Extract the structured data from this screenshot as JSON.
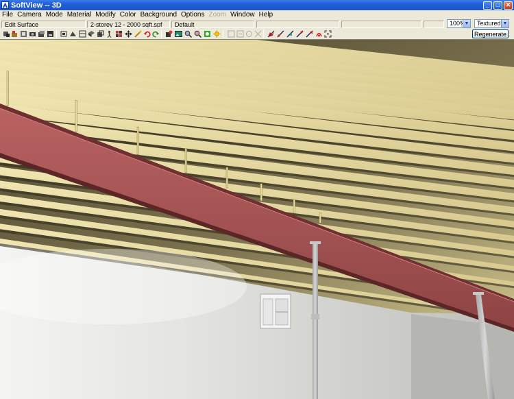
{
  "window": {
    "title": "SoftView -- 3D",
    "minimize": "_",
    "maximize": "□",
    "close": "✕"
  },
  "menu": [
    "File",
    "Camera",
    "Mode",
    "Material",
    "Modify",
    "Color",
    "Background",
    "Options",
    "Zoom",
    "Window",
    "Help"
  ],
  "menu_disabled": [
    "Zoom"
  ],
  "info": {
    "mode": "Edit Surface",
    "file": "2-storey 12 - 2000 sqft.spf",
    "layer": "Default",
    "zoom": "100%",
    "render": "Textured"
  },
  "toolbar": {
    "regenerate": "Regenerate"
  },
  "colors": {
    "titlebar": "#1f5fd8",
    "beam": "#a04f4f",
    "joist": "#e8dca0",
    "wall": "#d6d6d2",
    "ceiling_shadow": "#3a3422"
  }
}
